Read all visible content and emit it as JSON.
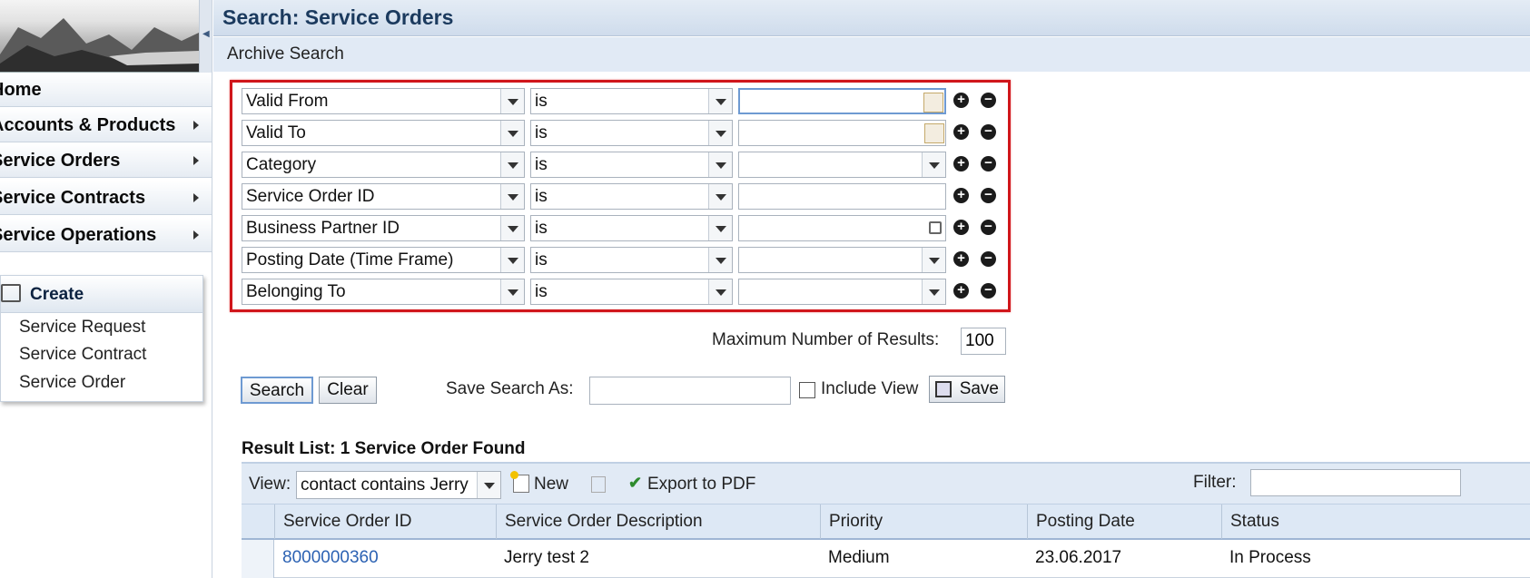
{
  "sidebar": {
    "nav": [
      {
        "label": "Home",
        "arrow": false
      },
      {
        "label": "Accounts & Products",
        "arrow": true
      },
      {
        "label": "Service Orders",
        "arrow": true
      },
      {
        "label": "Service Contracts",
        "arrow": true
      },
      {
        "label": "Service Operations",
        "arrow": true
      }
    ],
    "create": {
      "title": "Create",
      "links": [
        "Service Request",
        "Service Contract",
        "Service Order"
      ]
    }
  },
  "header": {
    "title": "Search: Service Orders",
    "subtitle": "Archive Search"
  },
  "criteria": [
    {
      "field": "Valid From",
      "operator": "is",
      "value_type": "date",
      "focused": true
    },
    {
      "field": "Valid To",
      "operator": "is",
      "value_type": "date"
    },
    {
      "field": "Category",
      "operator": "is",
      "value_type": "dropdown"
    },
    {
      "field": "Service Order ID",
      "operator": "is",
      "value_type": "text"
    },
    {
      "field": "Business Partner ID",
      "operator": "is",
      "value_type": "valuehelp"
    },
    {
      "field": "Posting Date (Time Frame)",
      "operator": "is",
      "value_type": "dropdown"
    },
    {
      "field": "Belonging To",
      "operator": "is",
      "value_type": "dropdown"
    }
  ],
  "options": {
    "max_results_label": "Maximum Number of Results:",
    "max_results_value": "100",
    "search_label": "Search",
    "clear_label": "Clear",
    "save_search_label": "Save Search As:",
    "include_view_label": "Include View",
    "save_label": "Save"
  },
  "results": {
    "title": "Result List: 1 Service Order Found",
    "view_label": "View:",
    "view_value": "contact contains Jerry",
    "new_label": "New",
    "export_label": "Export to PDF",
    "filter_label": "Filter:",
    "columns": [
      "Service Order ID",
      "Service Order Description",
      "Priority",
      "Posting Date",
      "Status"
    ],
    "rows": [
      [
        "8000000360",
        "Jerry test 2",
        "Medium",
        "23.06.2017",
        "In Process"
      ]
    ]
  },
  "icons": {
    "plus": "add-row-icon",
    "minus": "remove-row-icon",
    "calendar": "calendar-icon",
    "valuehelp": "value-help-icon"
  }
}
